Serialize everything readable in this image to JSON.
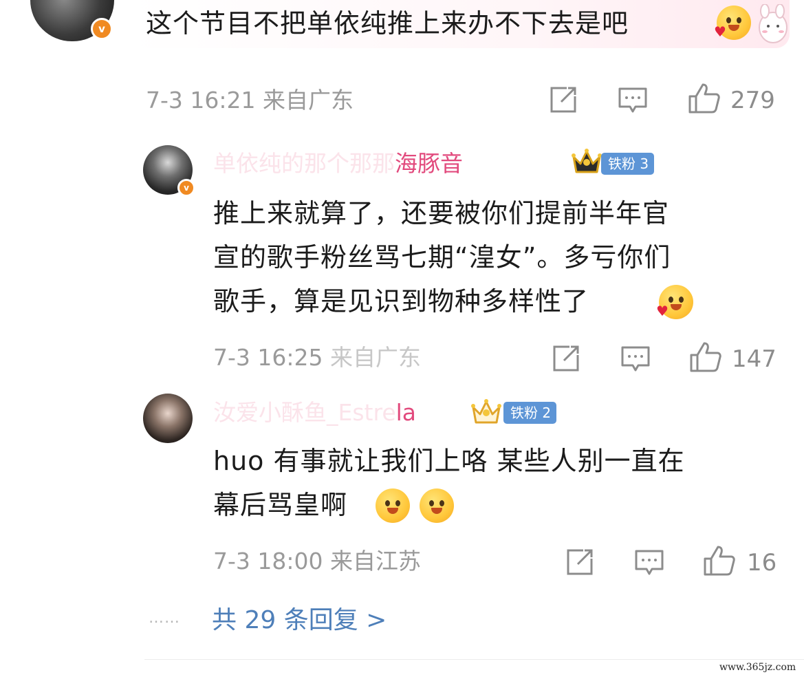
{
  "comment_top": {
    "text": "这个节目不把单依纯推上来办不下去是吧",
    "meta": "7-3 16:21 来自广东",
    "likes": "279"
  },
  "reply_1": {
    "username_blur": "单依纯的那个那那",
    "username_clear": "海豚音",
    "fan_badge": "铁粉 3",
    "text_lines": [
      "推上来就算了，还要被你们提前半年官",
      "宣的歌手粉丝骂七期“湟女”。多亏你们",
      "歌手，算是见识到物种多样性了"
    ],
    "meta_clear": "7-3 16:25",
    "meta_faded": "来自广东",
    "likes": "147"
  },
  "reply_2": {
    "username_blur": "汝爱小酥鱼_Estre",
    "username_clear": "la",
    "fan_badge": "铁粉 2",
    "text_lines": [
      "huo 有事就让我们上咯 某些人别一直在",
      "幕后骂皇啊"
    ],
    "meta": "7-3 18:00 来自江苏",
    "likes": "16"
  },
  "footer": {
    "dots": "……",
    "reply_count": "共 29 条回复 >"
  },
  "watermark": "www.365jz.com",
  "colors": {
    "badge_orange": "#f08a22",
    "fan_badge_blue": "#5d95d6",
    "link_blue": "#4e7fb9",
    "username_pink": "#e24a7d"
  },
  "icons": [
    "share-icon",
    "comment-icon",
    "like-icon",
    "crown-icon",
    "verified-icon",
    "emoji-icon"
  ]
}
